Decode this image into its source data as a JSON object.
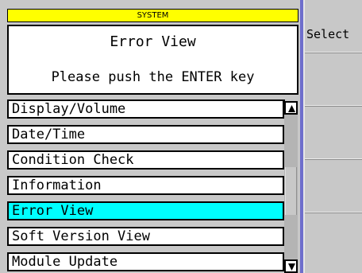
{
  "header": {
    "title": "SYSTEM"
  },
  "info": {
    "title": "Error View",
    "message": "Please push the ENTER key"
  },
  "menu": {
    "items": [
      {
        "label": "Display/Volume"
      },
      {
        "label": "Date/Time"
      },
      {
        "label": "Condition Check"
      },
      {
        "label": "Information"
      },
      {
        "label": "Error View",
        "selected": true
      },
      {
        "label": "Soft Version View"
      },
      {
        "label": "Module Update"
      }
    ],
    "selected_index": 4
  },
  "softkeys": {
    "key1": "Select",
    "key2": "",
    "key3": "",
    "key4": "",
    "key5": ""
  },
  "icons": {
    "scroll_up": "triangle-up-icon",
    "scroll_down": "triangle-down-icon"
  },
  "colors": {
    "header_bg": "#ffff00",
    "selected_bg": "#00ffff",
    "divider": "#6e6ecc",
    "panel_bg": "#c8c8c8"
  }
}
